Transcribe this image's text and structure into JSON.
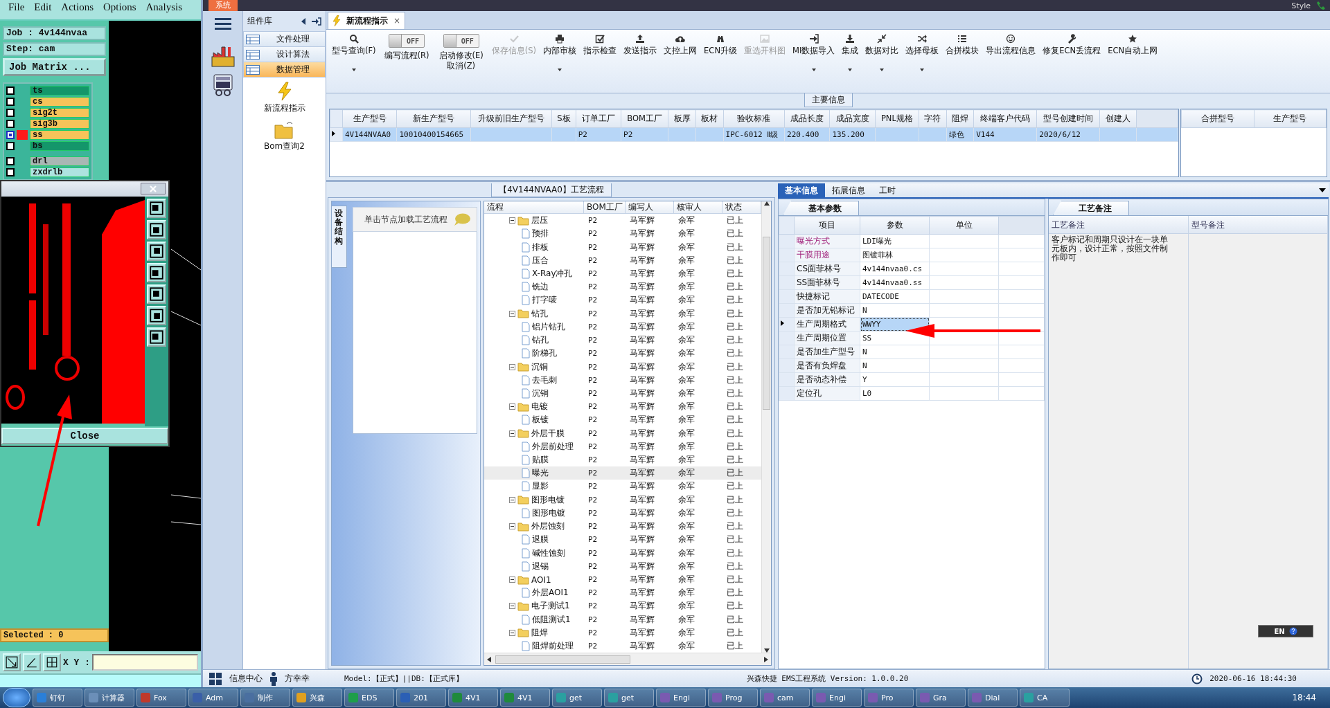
{
  "cam": {
    "menu": [
      "File",
      "Edit",
      "Actions",
      "Options",
      "Analysis"
    ],
    "job": "Job : 4v144nvaa",
    "step": "Step: cam",
    "matrix_button": "Job Matrix ...",
    "layers": [
      {
        "name": "ts",
        "color": "#14966a",
        "selected": false
      },
      {
        "name": "cs",
        "color": "#f6c35a",
        "selected": false
      },
      {
        "name": "sig2t",
        "color": "#f6c35a",
        "selected": false
      },
      {
        "name": "sig3b",
        "color": "#f6c35a",
        "selected": false
      },
      {
        "name": "ss",
        "color": "#f6c35a",
        "selected": true
      },
      {
        "name": "bs",
        "color": "#14966a",
        "selected": false
      },
      {
        "name": "drl",
        "color": "#a9b7b4",
        "selected": false
      },
      {
        "name": "zxdrlb",
        "color": "#aee3e0",
        "selected": false
      }
    ],
    "viewer": {
      "close": "Close"
    },
    "selected_count": "Selected : 0",
    "xy_label": "X Y :"
  },
  "top_right": {
    "style_menu": "Style"
  },
  "app": {
    "system_tab": "系统",
    "library": {
      "title": "组件库",
      "items": [
        {
          "label": "文件处理",
          "selected": false
        },
        {
          "label": "设计算法",
          "selected": false
        },
        {
          "label": "数据管理",
          "selected": true
        }
      ]
    },
    "shortcuts": [
      {
        "label": "新流程指示",
        "kind": "lightning"
      },
      {
        "label": "Bom查询2",
        "kind": "folder"
      }
    ],
    "footer": {
      "info_center": "信息中心",
      "user": "方幸幸"
    }
  },
  "doc_tab": {
    "title": "新流程指示",
    "close": "×"
  },
  "ribbon": [
    {
      "kind": "button",
      "label": "型号查询(F)",
      "caret": true,
      "disabled": false
    },
    {
      "kind": "toggle",
      "label": "编写流程(R)",
      "state_text": "OFF",
      "on": false
    },
    {
      "kind": "toggle",
      "label": "启动修改(E)",
      "label_2": "取消(Z)",
      "state_text": "OFF",
      "on": false
    },
    {
      "kind": "button",
      "label": "保存信息(S)",
      "caret": false,
      "disabled": true
    },
    {
      "kind": "button",
      "label": "内部审核",
      "caret": true,
      "disabled": false
    },
    {
      "kind": "button",
      "label": "指示检查",
      "caret": false,
      "disabled": false
    },
    {
      "kind": "button",
      "label": "发送指示",
      "caret": false,
      "disabled": false
    },
    {
      "kind": "button",
      "label": "文控上网",
      "caret": false,
      "disabled": false
    },
    {
      "kind": "button",
      "label": "ECN升级",
      "caret": false,
      "disabled": false
    },
    {
      "kind": "button",
      "label": "重选开料图",
      "caret": false,
      "disabled": true
    },
    {
      "kind": "button",
      "label": "MI数据导入",
      "caret": true,
      "disabled": false
    },
    {
      "kind": "button",
      "label": "集成",
      "caret": true,
      "disabled": false
    },
    {
      "kind": "button",
      "label": "数据对比",
      "caret": true,
      "disabled": false
    },
    {
      "kind": "button",
      "label": "选择母板",
      "caret": true,
      "disabled": false
    },
    {
      "kind": "button",
      "label": "合拼模块",
      "caret": false,
      "disabled": false
    },
    {
      "kind": "button",
      "label": "导出流程信息",
      "caret": false,
      "disabled": false
    },
    {
      "kind": "button",
      "label": "修复ECN丢流程",
      "caret": false,
      "disabled": false
    },
    {
      "kind": "button",
      "label": "ECN自动上网",
      "caret": false,
      "disabled": false
    }
  ],
  "main_info": {
    "title": "主要信息",
    "columns": [
      "生产型号",
      "新生产型号",
      "升级前旧生产型号",
      "S板",
      "订单工厂",
      "BOM工厂",
      "板厚",
      "板材",
      "验收标准",
      "成品长度",
      "成品宽度",
      "PNL规格",
      "字符",
      "阻焊",
      "终端客户代码",
      "型号创建时间",
      "创建人"
    ],
    "rows": [
      {
        "selected": true,
        "cells": [
          "4V144NVAA0",
          "10010400154665",
          "",
          "",
          "P2",
          "P2",
          "",
          "",
          "IPC-6012 Ⅱ级",
          "220.400",
          "135.200",
          "",
          "",
          "绿色",
          "V144",
          "2020/6/12",
          ""
        ]
      }
    ],
    "merge_columns": [
      "合拼型号",
      "生产型号"
    ]
  },
  "process": {
    "title": "【4V144NVAA0】工艺流程",
    "side_tab": "设备结构",
    "hint": "单击节点加载工艺流程",
    "columns": [
      "流程",
      "BOM工厂",
      "编写人",
      "核审人",
      "状态"
    ],
    "tree": [
      {
        "label": "层压",
        "bom": "P2",
        "writer": "马军辉",
        "reviewer": "余军",
        "status": "已上",
        "selected": false,
        "children": [
          {
            "label": "预排",
            "bom": "P2",
            "writer": "马军辉",
            "reviewer": "余军",
            "status": "已上",
            "selected": false
          },
          {
            "label": "排板",
            "bom": "P2",
            "writer": "马军辉",
            "reviewer": "余军",
            "status": "已上",
            "selected": false
          },
          {
            "label": "压合",
            "bom": "P2",
            "writer": "马军辉",
            "reviewer": "余军",
            "status": "已上",
            "selected": false
          },
          {
            "label": "X-Ray冲孔",
            "bom": "P2",
            "writer": "马军辉",
            "reviewer": "余军",
            "status": "已上",
            "selected": false
          },
          {
            "label": "铣边",
            "bom": "P2",
            "writer": "马军辉",
            "reviewer": "余军",
            "status": "已上",
            "selected": false
          },
          {
            "label": "打字唛",
            "bom": "P2",
            "writer": "马军辉",
            "reviewer": "余军",
            "status": "已上",
            "selected": false
          }
        ]
      },
      {
        "label": "钻孔",
        "bom": "P2",
        "writer": "马军辉",
        "reviewer": "余军",
        "status": "已上",
        "selected": false,
        "children": [
          {
            "label": "铝片钻孔",
            "bom": "P2",
            "writer": "马军辉",
            "reviewer": "余军",
            "status": "已上",
            "selected": false
          },
          {
            "label": "钻孔",
            "bom": "P2",
            "writer": "马军辉",
            "reviewer": "余军",
            "status": "已上",
            "selected": false
          },
          {
            "label": "阶梯孔",
            "bom": "P2",
            "writer": "马军辉",
            "reviewer": "余军",
            "status": "已上",
            "selected": false
          }
        ]
      },
      {
        "label": "沉铜",
        "bom": "P2",
        "writer": "马军辉",
        "reviewer": "余军",
        "status": "已上",
        "selected": false,
        "children": [
          {
            "label": "去毛刺",
            "bom": "P2",
            "writer": "马军辉",
            "reviewer": "余军",
            "status": "已上",
            "selected": false
          },
          {
            "label": "沉铜",
            "bom": "P2",
            "writer": "马军辉",
            "reviewer": "余军",
            "status": "已上",
            "selected": false
          }
        ]
      },
      {
        "label": "电镀",
        "bom": "P2",
        "writer": "马军辉",
        "reviewer": "余军",
        "status": "已上",
        "selected": false,
        "children": [
          {
            "label": "板镀",
            "bom": "P2",
            "writer": "马军辉",
            "reviewer": "余军",
            "status": "已上",
            "selected": false
          }
        ]
      },
      {
        "label": "外层干膜",
        "bom": "P2",
        "writer": "马军辉",
        "reviewer": "余军",
        "status": "已上",
        "selected": false,
        "children": [
          {
            "label": "外层前处理",
            "bom": "P2",
            "writer": "马军辉",
            "reviewer": "余军",
            "status": "已上",
            "selected": false
          },
          {
            "label": "贴膜",
            "bom": "P2",
            "writer": "马军辉",
            "reviewer": "余军",
            "status": "已上",
            "selected": false
          },
          {
            "label": "曝光",
            "bom": "P2",
            "writer": "马军辉",
            "reviewer": "余军",
            "status": "已上",
            "selected": true
          },
          {
            "label": "显影",
            "bom": "P2",
            "writer": "马军辉",
            "reviewer": "余军",
            "status": "已上",
            "selected": false
          }
        ]
      },
      {
        "label": "图形电镀",
        "bom": "P2",
        "writer": "马军辉",
        "reviewer": "余军",
        "status": "已上",
        "selected": false,
        "children": [
          {
            "label": "图形电镀",
            "bom": "P2",
            "writer": "马军辉",
            "reviewer": "余军",
            "status": "已上",
            "selected": false
          }
        ]
      },
      {
        "label": "外层蚀刻",
        "bom": "P2",
        "writer": "马军辉",
        "reviewer": "余军",
        "status": "已上",
        "selected": false,
        "children": [
          {
            "label": "退膜",
            "bom": "P2",
            "writer": "马军辉",
            "reviewer": "余军",
            "status": "已上",
            "selected": false
          },
          {
            "label": "碱性蚀刻",
            "bom": "P2",
            "writer": "马军辉",
            "reviewer": "余军",
            "status": "已上",
            "selected": false
          },
          {
            "label": "退锡",
            "bom": "P2",
            "writer": "马军辉",
            "reviewer": "余军",
            "status": "已上",
            "selected": false
          }
        ]
      },
      {
        "label": "AOI1",
        "bom": "P2",
        "writer": "马军辉",
        "reviewer": "余军",
        "status": "已上",
        "selected": false,
        "children": [
          {
            "label": "外层AOI1",
            "bom": "P2",
            "writer": "马军辉",
            "reviewer": "余军",
            "status": "已上",
            "selected": false
          }
        ]
      },
      {
        "label": "电子测试1",
        "bom": "P2",
        "writer": "马军辉",
        "reviewer": "余军",
        "status": "已上",
        "selected": false,
        "children": [
          {
            "label": "低阻测试1",
            "bom": "P2",
            "writer": "马军辉",
            "reviewer": "余军",
            "status": "已上",
            "selected": false
          }
        ]
      },
      {
        "label": "阻焊",
        "bom": "P2",
        "writer": "马军辉",
        "reviewer": "余军",
        "status": "已上",
        "selected": false,
        "children": [
          {
            "label": "阻焊前处理",
            "bom": "P2",
            "writer": "马军辉",
            "reviewer": "余军",
            "status": "已上",
            "selected": false
          }
        ]
      }
    ]
  },
  "details": {
    "tabs": [
      {
        "label": "基本信息",
        "selected": true
      },
      {
        "label": "拓展信息",
        "selected": false
      },
      {
        "label": "工时",
        "selected": false
      }
    ],
    "params": {
      "tab": "基本参数",
      "columns": [
        "项目",
        "参数",
        "单位"
      ],
      "rows": [
        {
          "item": "曝光方式",
          "value": "LDI曝光",
          "required": true,
          "selected": false
        },
        {
          "item": "干膜用途",
          "value": "图镀菲林",
          "required": true,
          "selected": false
        },
        {
          "item": "CS面菲林号",
          "value": "4v144nvaa0.cs",
          "required": false,
          "selected": false
        },
        {
          "item": "SS面菲林号",
          "value": "4v144nvaa0.ss",
          "required": false,
          "selected": false
        },
        {
          "item": "快捷标记",
          "value": "DATECODE",
          "required": false,
          "selected": false
        },
        {
          "item": "是否加无铅标记",
          "value": "N",
          "required": false,
          "selected": false
        },
        {
          "item": "生产周期格式",
          "value": "WWYY",
          "required": false,
          "selected": true
        },
        {
          "item": "生产周期位置",
          "value": "SS",
          "required": false,
          "selected": false
        },
        {
          "item": "是否加生产型号",
          "value": "N",
          "required": false,
          "selected": false
        },
        {
          "item": "是否有负焊盘",
          "value": "N",
          "required": false,
          "selected": false
        },
        {
          "item": "是否动态补偿",
          "value": "Y",
          "required": false,
          "selected": false
        },
        {
          "item": "定位孔",
          "value": "L0",
          "required": false,
          "selected": false
        }
      ]
    },
    "remarks": {
      "tab": "工艺备注",
      "columns": [
        "工艺备注",
        "型号备注"
      ],
      "text": "客户标记和周期只设计在一块单元板内，设计正常，按照文件制作即可"
    }
  },
  "language": "EN",
  "status_bar": {
    "model": "Model:【正式】||DB:【正式库】",
    "system": "兴森快捷 EMS工程系统 Version: 1.0.0.20",
    "time": "2020-06-16 18:44:30"
  },
  "taskbar": {
    "items": [
      "钉钉",
      "计算器",
      "Fox",
      "Adm",
      "制作",
      "兴森",
      "EDS",
      "201",
      "4V1",
      "4V1",
      "get",
      "get",
      "Engi",
      "Prog",
      "cam",
      "Engi",
      "Pro",
      "Gra",
      "Dial",
      "CA"
    ],
    "clock": "18:44"
  }
}
